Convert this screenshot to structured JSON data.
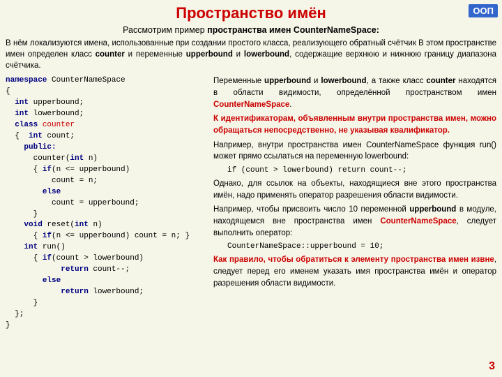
{
  "page": {
    "title": "Пространство имён",
    "oop_label": "ООП",
    "subtitle_plain": "Рассмотрим пример ",
    "subtitle_bold": "пространства имен CounterNameSpace:",
    "intro": "В нём локализуются имена, использованные при создании простого класса, реализующего обратный счётчик В этом пространстве имен определен класс counter и переменные upperbound и lowerbound, содержащие верхнюю и нижнюю границу диапазона счётчика.",
    "page_number": "3"
  }
}
